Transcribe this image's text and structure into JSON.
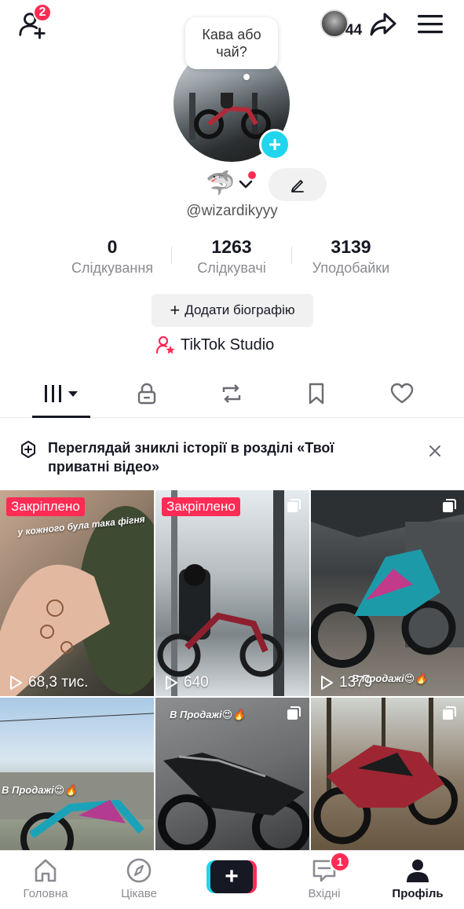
{
  "topbar": {
    "friend_requests_count": "2",
    "story_viewers_count": "44",
    "bubble_text": "Кава або чай?"
  },
  "profile": {
    "emoji": "🦈",
    "username": "@wizardikyyy",
    "stats": [
      {
        "value": "0",
        "label": "Слідкування"
      },
      {
        "value": "1263",
        "label": "Слідкувачі"
      },
      {
        "value": "3139",
        "label": "Уподобайки"
      }
    ],
    "bio_button_label": "Додати біографію",
    "studio_label": "TikTok Studio"
  },
  "tabs": [
    "videos",
    "private",
    "reposts",
    "favorites",
    "liked"
  ],
  "notice": {
    "text": "Переглядай зниклі історії в розділі «Твої приватні відео»"
  },
  "grid": [
    {
      "pinned_label": "Закріплено",
      "views": "68,3 тис.",
      "caption": "у кожного була така фігня"
    },
    {
      "pinned_label": "Закріплено",
      "views": "640",
      "caption": ""
    },
    {
      "pinned_label": "",
      "views": "1379",
      "caption": "В Продажі😍🔥"
    },
    {
      "pinned_label": "",
      "views": "",
      "caption": "В Продажі😍🔥"
    },
    {
      "pinned_label": "",
      "views": "",
      "caption": "В Продажі😍🔥"
    },
    {
      "pinned_label": "",
      "views": "",
      "caption": ""
    }
  ],
  "bottom_nav": [
    {
      "label": "Головна",
      "icon": "home-icon"
    },
    {
      "label": "Цікаве",
      "icon": "compass-icon"
    },
    {
      "label": "",
      "icon": "plus-icon"
    },
    {
      "label": "Вхідні",
      "icon": "inbox-icon",
      "badge": "1"
    },
    {
      "label": "Профіль",
      "icon": "profile-icon",
      "active": true
    }
  ],
  "colors": {
    "accent_red": "#fe2c55",
    "accent_cyan": "#20d5ec",
    "text_primary": "#161823",
    "text_secondary": "#8a8b91"
  }
}
